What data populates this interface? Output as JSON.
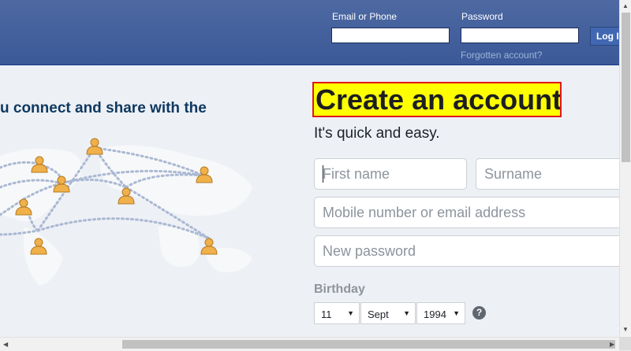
{
  "login": {
    "email_label": "Email or Phone",
    "password_label": "Password",
    "login_button": "Log In",
    "forgot_link": "Forgotten account?"
  },
  "hero": {
    "tagline": "u connect and share with the"
  },
  "signup": {
    "title": "Create an account",
    "subtitle": "It's quick and easy.",
    "first_name_placeholder": "First name",
    "surname_placeholder": "Surname",
    "mobile_placeholder": "Mobile number or email address",
    "password_placeholder": "New password",
    "birthday_label": "Birthday",
    "birthday_day": "11",
    "birthday_month": "Sept",
    "birthday_year": "1994",
    "help_glyph": "?"
  },
  "colors": {
    "brand_blue": "#3b5998",
    "highlight": "#ffff00",
    "highlight_border": "#e01818"
  }
}
